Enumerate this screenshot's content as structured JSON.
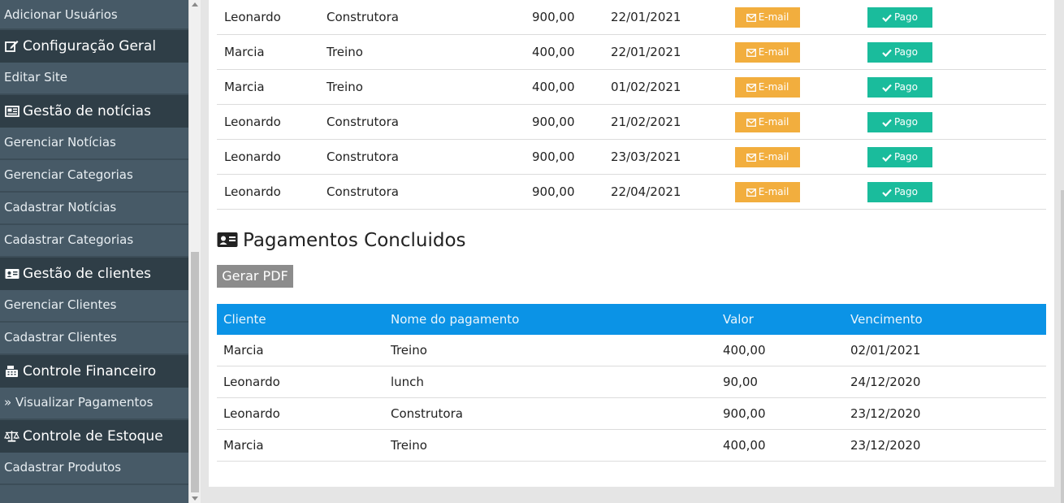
{
  "sidebar": {
    "top_item": "Adicionar Usuários",
    "sections": [
      {
        "title": "Configuração Geral",
        "icon": "edit-icon",
        "items": [
          "Editar Site"
        ]
      },
      {
        "title": "Gestão de notícias",
        "icon": "newspaper-icon",
        "items": [
          "Gerenciar Notícias",
          "Gerenciar Categorias",
          "Cadastrar Notícias",
          "Cadastrar Categorias"
        ]
      },
      {
        "title": "Gestão de clientes",
        "icon": "id-card-icon",
        "items": [
          "Gerenciar Clientes",
          "Cadastrar Clientes"
        ]
      },
      {
        "title": "Controle Financeiro",
        "icon": "cash-register-icon",
        "items": [
          "» Visualizar Pagamentos"
        ]
      },
      {
        "title": "Controle de Estoque",
        "icon": "balance-scale-icon",
        "items": [
          "Cadastrar Produtos"
        ]
      }
    ]
  },
  "pending": {
    "email_label": "E-mail",
    "paid_label": "Pago",
    "rows": [
      {
        "cliente": "Leonardo",
        "nome": "Construtora",
        "valor": "900,00",
        "vencimento": "22/01/2021"
      },
      {
        "cliente": "Marcia",
        "nome": "Treino",
        "valor": "400,00",
        "vencimento": "22/01/2021"
      },
      {
        "cliente": "Marcia",
        "nome": "Treino",
        "valor": "400,00",
        "vencimento": "01/02/2021"
      },
      {
        "cliente": "Leonardo",
        "nome": "Construtora",
        "valor": "900,00",
        "vencimento": "21/02/2021"
      },
      {
        "cliente": "Leonardo",
        "nome": "Construtora",
        "valor": "900,00",
        "vencimento": "23/03/2021"
      },
      {
        "cliente": "Leonardo",
        "nome": "Construtora",
        "valor": "900,00",
        "vencimento": "22/04/2021"
      }
    ]
  },
  "completed": {
    "title": "Pagamentos Concluidos",
    "pdf_label": "Gerar PDF",
    "headers": [
      "Cliente",
      "Nome do pagamento",
      "Valor",
      "Vencimento"
    ],
    "rows": [
      {
        "cliente": "Marcia",
        "nome": "Treino",
        "valor": "400,00",
        "vencimento": "02/01/2021"
      },
      {
        "cliente": "Leonardo",
        "nome": "lunch",
        "valor": "90,00",
        "vencimento": "24/12/2020"
      },
      {
        "cliente": "Leonardo",
        "nome": "Construtora",
        "valor": "900,00",
        "vencimento": "23/12/2020"
      },
      {
        "cliente": "Marcia",
        "nome": "Treino",
        "valor": "400,00",
        "vencimento": "23/12/2020"
      }
    ]
  },
  "colors": {
    "sidebar_bg": "#475a67",
    "sidebar_header_bg": "#2f3e47",
    "email_button": "#f2ae3e",
    "paid_button": "#1abc9c",
    "table_header": "#0b93e6",
    "pdf_button": "#8c8c8c"
  }
}
